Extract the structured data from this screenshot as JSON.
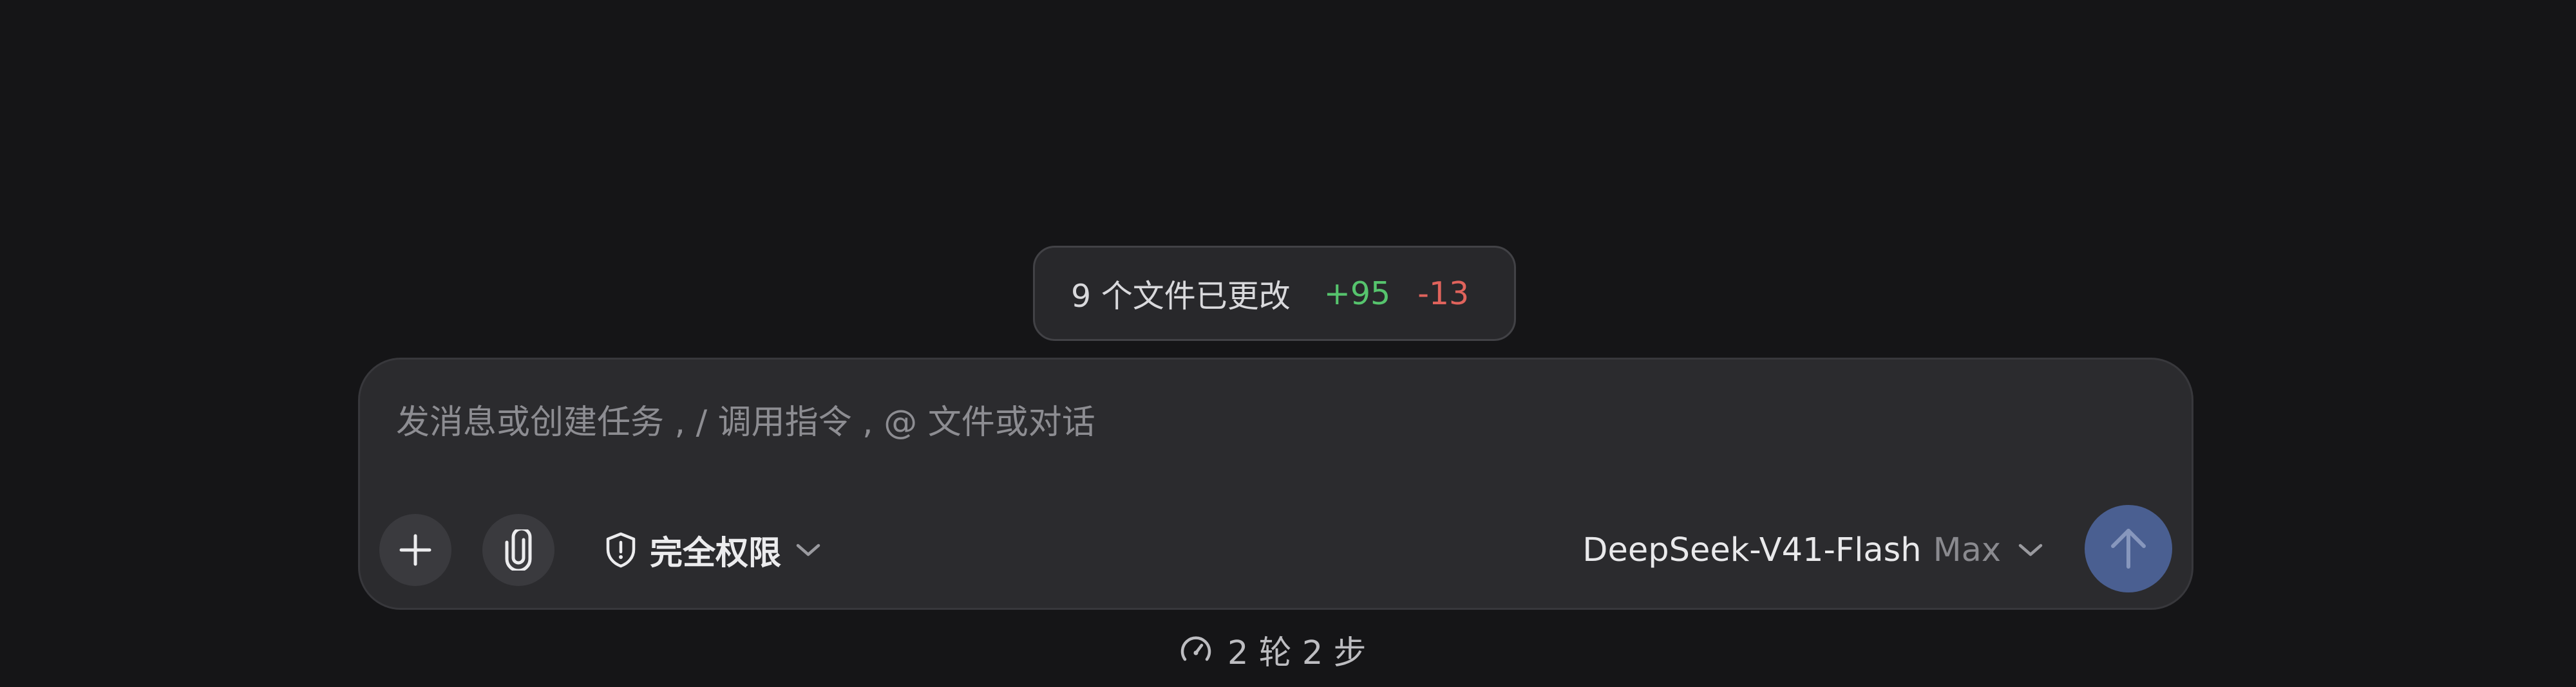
{
  "changes": {
    "summary": "9 个文件已更改",
    "additions": "+95",
    "deletions": "-13"
  },
  "composer": {
    "placeholder": "发消息或创建任务 , / 调用指令 , @ 文件或对话",
    "value": "",
    "permission_label": "完全权限",
    "model_name": "DeepSeek-V41-Flash",
    "model_mode": "Max"
  },
  "icons": {
    "add": "plus-icon",
    "attach": "paperclip-icon",
    "permission": "shield-icon",
    "dropdown": "chevron-down-icon",
    "send": "arrow-up-icon",
    "steps": "gauge-icon"
  },
  "footer": {
    "steps_text": "2 轮 2 步"
  },
  "colors": {
    "background": "#151517",
    "additions": "#56c46d",
    "deletions": "#e0635c",
    "send_button": "#4a5f91"
  }
}
